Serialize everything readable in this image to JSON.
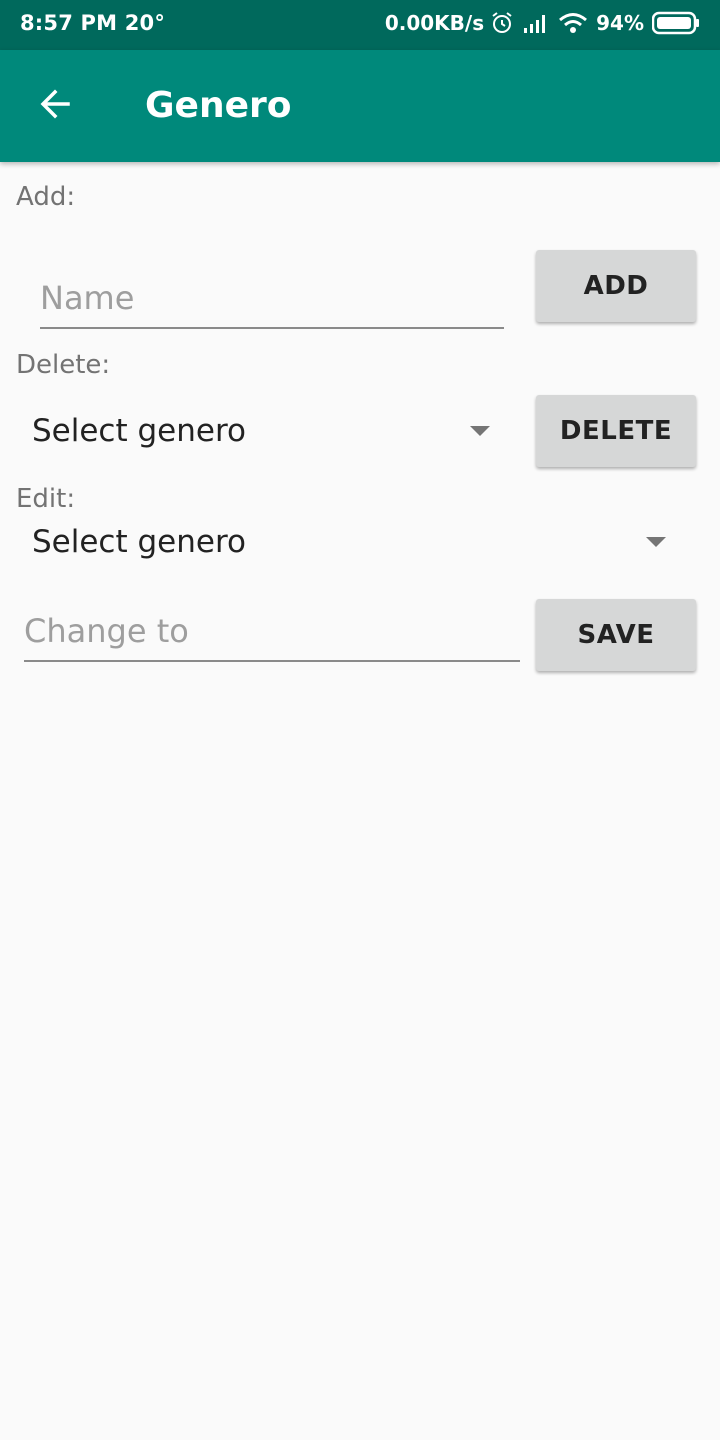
{
  "status_bar": {
    "time": "8:57 PM",
    "temperature": "20°",
    "network_speed": "0.00KB/s",
    "battery": "94%",
    "icons": [
      "alarm-icon",
      "signal-icon",
      "wifi-icon",
      "battery-icon"
    ]
  },
  "toolbar": {
    "title": "Genero",
    "back_icon": "arrow-left-icon",
    "color": "#00897b"
  },
  "add_section": {
    "label": "Add:",
    "name_placeholder": "Name",
    "name_value": "",
    "button_label": "ADD"
  },
  "delete_section": {
    "label": "Delete:",
    "selected": "Select genero",
    "button_label": "DELETE"
  },
  "edit_section": {
    "label": "Edit:",
    "selected": "Select genero",
    "change_placeholder": "Change to",
    "change_value": "",
    "button_label": "SAVE"
  }
}
